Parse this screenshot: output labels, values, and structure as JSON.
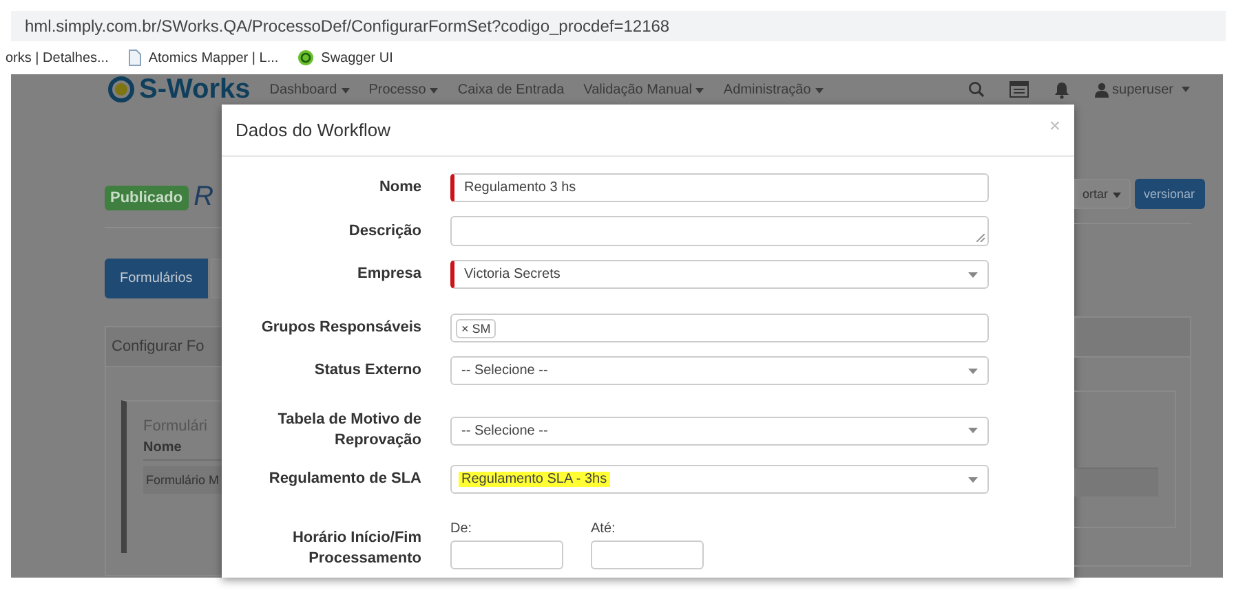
{
  "browser": {
    "url": "hml.simply.com.br/SWorks.QA/ProcessoDef/ConfigurarFormSet?codigo_procdef=12168",
    "bookmarks": [
      {
        "label": "orks | Detalhes...",
        "kind": "none"
      },
      {
        "label": "Atomics Mapper | L...",
        "kind": "page"
      },
      {
        "label": "Swagger UI",
        "kind": "swagger"
      }
    ]
  },
  "nav": {
    "logo": "S-Works",
    "items": [
      {
        "label": "Dashboard",
        "dropdown": true
      },
      {
        "label": "Processo",
        "dropdown": true
      },
      {
        "label": "Caixa de Entrada",
        "dropdown": false
      },
      {
        "label": "Validação Manual",
        "dropdown": true
      },
      {
        "label": "Administração",
        "dropdown": true
      }
    ],
    "user": "superuser"
  },
  "page": {
    "status_badge": "Publicado",
    "title": "R",
    "tabs": [
      {
        "label": "Formulários",
        "selected": true
      }
    ],
    "actions": [
      {
        "label": "ortar",
        "kind": "dropdown"
      },
      {
        "label": "versionar",
        "kind": "primary"
      }
    ],
    "panel": {
      "heading": "Configurar Fo",
      "section_title": "Formulári",
      "table_header": "Nome",
      "table_row": "Formulário M"
    }
  },
  "modal": {
    "title": "Dados do Workflow",
    "close": "×",
    "fields": [
      {
        "label": "Nome",
        "kind": "text",
        "required": true,
        "highlighted": false,
        "value": "Regulamento 3 hs"
      },
      {
        "label": "Descrição",
        "kind": "textarea",
        "required": false
      },
      {
        "label": "Empresa",
        "kind": "select",
        "required": true,
        "highlighted": false,
        "value": "Victoria Secrets"
      },
      {
        "label": "Grupos Responsáveis",
        "kind": "tags",
        "required": false,
        "tags": [
          {
            "remove": "×",
            "label": "SM"
          }
        ]
      },
      {
        "label": "Status Externo",
        "kind": "select",
        "required": false,
        "highlighted": false,
        "value": "-- Selecione --"
      },
      {
        "label": "Tabela de Motivo de Reprovação",
        "kind": "select",
        "required": false,
        "highlighted": false,
        "value": "-- Selecione --"
      },
      {
        "label": "Regulamento de SLA",
        "kind": "select",
        "required": false,
        "highlighted": true,
        "value": "Regulamento SLA - 3hs"
      },
      {
        "label": "Horário Início/Fim Processamento",
        "kind": "time_range",
        "parts": [
          {
            "label": "De:"
          },
          {
            "label": "Até:"
          }
        ]
      }
    ]
  }
}
